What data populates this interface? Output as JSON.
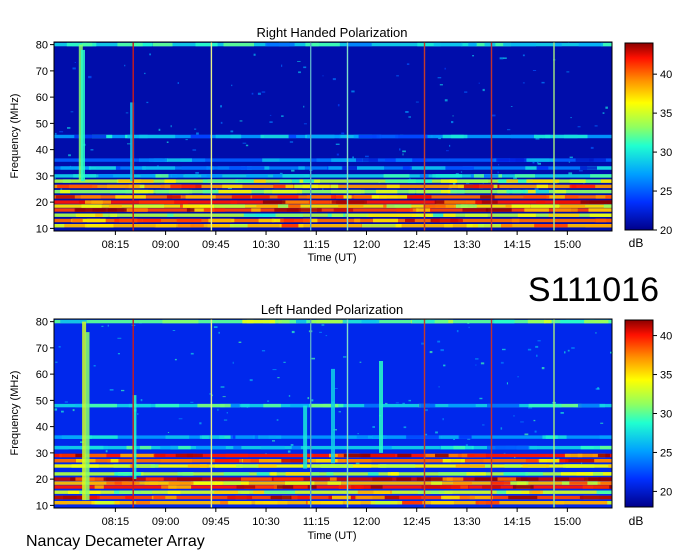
{
  "figure": {
    "station_id": "S111016",
    "footer": "Nancay Decameter Array"
  },
  "chart_data": [
    {
      "type": "heatmap",
      "title": "Right Handed Polarization",
      "xlabel": "Time (UT)",
      "ylabel": "Frequency (MHz)",
      "x_ticks": [
        "08:15",
        "09:00",
        "09:45",
        "10:30",
        "11:15",
        "12:00",
        "12:45",
        "13:30",
        "14:15",
        "15:00"
      ],
      "x_tick_minutes": [
        495,
        540,
        585,
        630,
        675,
        720,
        765,
        810,
        855,
        900
      ],
      "xlim_minutes": [
        440,
        940
      ],
      "y_ticks": [
        10,
        20,
        30,
        40,
        50,
        60,
        70,
        80
      ],
      "ylim": [
        9,
        81
      ],
      "colorbar": {
        "label": "dB",
        "ticks": [
          20,
          25,
          30,
          35,
          40
        ],
        "range": [
          20,
          44
        ]
      },
      "background_level_db": 21,
      "strong_bands_mhz": [
        {
          "f": 11,
          "db": 38
        },
        {
          "f": 13,
          "db": 40
        },
        {
          "f": 15,
          "db": 34
        },
        {
          "f": 17,
          "db": 41
        },
        {
          "f": 18.5,
          "db": 37
        },
        {
          "f": 20,
          "db": 42
        },
        {
          "f": 22,
          "db": 40
        },
        {
          "f": 24,
          "db": 33
        },
        {
          "f": 26,
          "db": 39
        },
        {
          "f": 28,
          "db": 34
        },
        {
          "f": 30,
          "db": 29
        },
        {
          "f": 33,
          "db": 26
        },
        {
          "f": 36,
          "db": 25
        },
        {
          "f": 45,
          "db": 27
        },
        {
          "f": 80,
          "db": 29
        }
      ],
      "vertical_lines": [
        {
          "t": 511,
          "color": "#cc1b1b"
        },
        {
          "t": 581,
          "color": "#e6f089"
        },
        {
          "t": 670,
          "color": "#59a8c9"
        },
        {
          "t": 703,
          "color": "#7fe0c8"
        },
        {
          "t": 772,
          "color": "#c33b2c"
        },
        {
          "t": 832,
          "color": "#c23030"
        },
        {
          "t": 888,
          "color": "#a6ea7e"
        }
      ],
      "bursts": [
        {
          "t": 464,
          "f0": 28,
          "f1": 80,
          "db": 33
        },
        {
          "t": 466,
          "f0": 28,
          "f1": 78,
          "db": 31
        },
        {
          "t": 510,
          "f0": 28,
          "f1": 58,
          "db": 29
        }
      ]
    },
    {
      "type": "heatmap",
      "title": "Left Handed Polarization",
      "xlabel": "Time (UT)",
      "ylabel": "Frequency (MHz)",
      "x_ticks": [
        "08:15",
        "09:00",
        "09:45",
        "10:30",
        "11:15",
        "12:00",
        "12:45",
        "13:30",
        "14:15",
        "15:00"
      ],
      "x_tick_minutes": [
        495,
        540,
        585,
        630,
        675,
        720,
        765,
        810,
        855,
        900
      ],
      "xlim_minutes": [
        440,
        940
      ],
      "y_ticks": [
        10,
        20,
        30,
        40,
        50,
        60,
        70,
        80
      ],
      "ylim": [
        9,
        81
      ],
      "colorbar": {
        "label": "dB",
        "ticks": [
          20,
          25,
          30,
          35,
          40
        ],
        "range": [
          18,
          42
        ]
      },
      "background_level_db": 21,
      "strong_bands_mhz": [
        {
          "f": 11,
          "db": 36
        },
        {
          "f": 13,
          "db": 39
        },
        {
          "f": 15,
          "db": 33
        },
        {
          "f": 17,
          "db": 40
        },
        {
          "f": 18.5,
          "db": 36
        },
        {
          "f": 20,
          "db": 41
        },
        {
          "f": 22,
          "db": 32
        },
        {
          "f": 25,
          "db": 34
        },
        {
          "f": 27,
          "db": 38
        },
        {
          "f": 29,
          "db": 40
        },
        {
          "f": 32,
          "db": 27
        },
        {
          "f": 36,
          "db": 25
        },
        {
          "f": 48,
          "db": 27
        },
        {
          "f": 80,
          "db": 30
        }
      ],
      "vertical_lines": [
        {
          "t": 511,
          "color": "#cc1b1b"
        },
        {
          "t": 581,
          "color": "#e6f089"
        },
        {
          "t": 670,
          "color": "#59a8c9"
        },
        {
          "t": 703,
          "color": "#7fe0c8"
        },
        {
          "t": 772,
          "color": "#c33b2c"
        },
        {
          "t": 832,
          "color": "#c23030"
        },
        {
          "t": 888,
          "color": "#a6ea7e"
        }
      ],
      "bursts": [
        {
          "t": 467,
          "f0": 12,
          "f1": 80,
          "db": 33
        },
        {
          "t": 470,
          "f0": 12,
          "f1": 76,
          "db": 31
        },
        {
          "t": 512,
          "f0": 20,
          "f1": 52,
          "db": 29
        },
        {
          "t": 665,
          "f0": 24,
          "f1": 48,
          "db": 28
        },
        {
          "t": 690,
          "f0": 26,
          "f1": 62,
          "db": 27
        },
        {
          "t": 733,
          "f0": 30,
          "f1": 65,
          "db": 29
        }
      ]
    }
  ]
}
